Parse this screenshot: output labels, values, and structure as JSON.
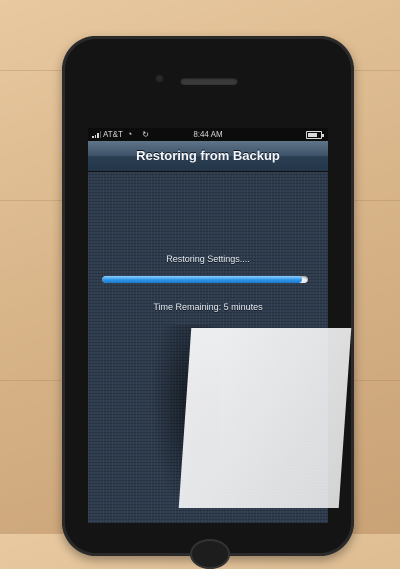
{
  "status_bar": {
    "carrier": "AT&T",
    "time": "8:44 AM",
    "icons": [
      "signal-icon",
      "wifi-icon",
      "sync-icon",
      "battery-icon"
    ]
  },
  "nav": {
    "title": "Restoring from Backup"
  },
  "restore": {
    "status_label": "Restoring Settings....",
    "progress_fraction": 0.97,
    "time_remaining": "Time Remaining: 5 minutes"
  },
  "colors": {
    "nav_bar": "#3d5168",
    "progress_blue": "#2e95e8",
    "background_linen": "#2e3c4e"
  }
}
